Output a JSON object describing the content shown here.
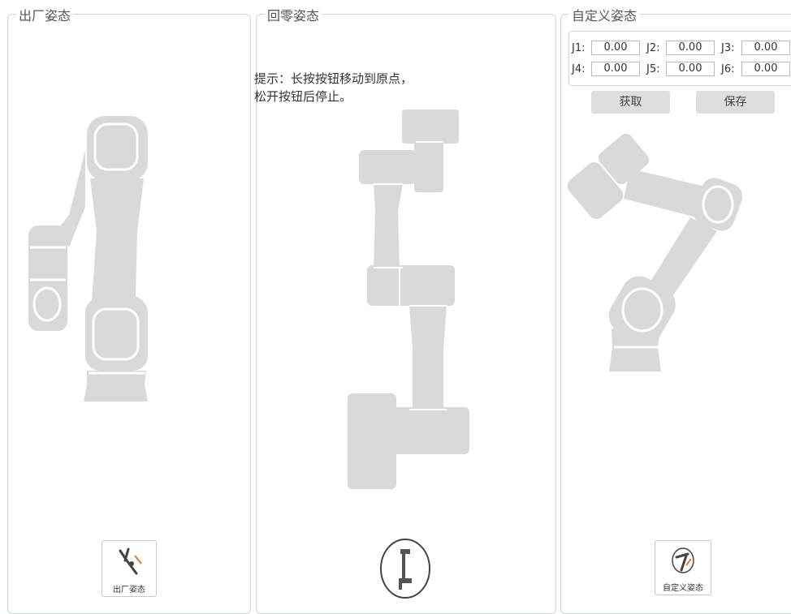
{
  "panels": {
    "factory": {
      "title": "出厂姿态"
    },
    "zero": {
      "title": "回零姿态",
      "hint_line1": "提示：长按按钮移动到原点，",
      "hint_line2": "松开按钮后停止。"
    },
    "custom": {
      "title": "自定义姿态"
    }
  },
  "joints": [
    {
      "label": "J1:",
      "value": "0.00"
    },
    {
      "label": "J2:",
      "value": "0.00"
    },
    {
      "label": "J3:",
      "value": "0.00"
    },
    {
      "label": "J4:",
      "value": "0.00"
    },
    {
      "label": "J5:",
      "value": "0.00"
    },
    {
      "label": "J6:",
      "value": "0.00"
    }
  ],
  "buttons": {
    "get": "获取",
    "save": "保存",
    "factory_pose": "出厂姿态",
    "custom_pose": "自定义姿态"
  },
  "colors": {
    "robot": "#d9d9d9",
    "border": "#cfd6d6",
    "button": "#dedede"
  }
}
